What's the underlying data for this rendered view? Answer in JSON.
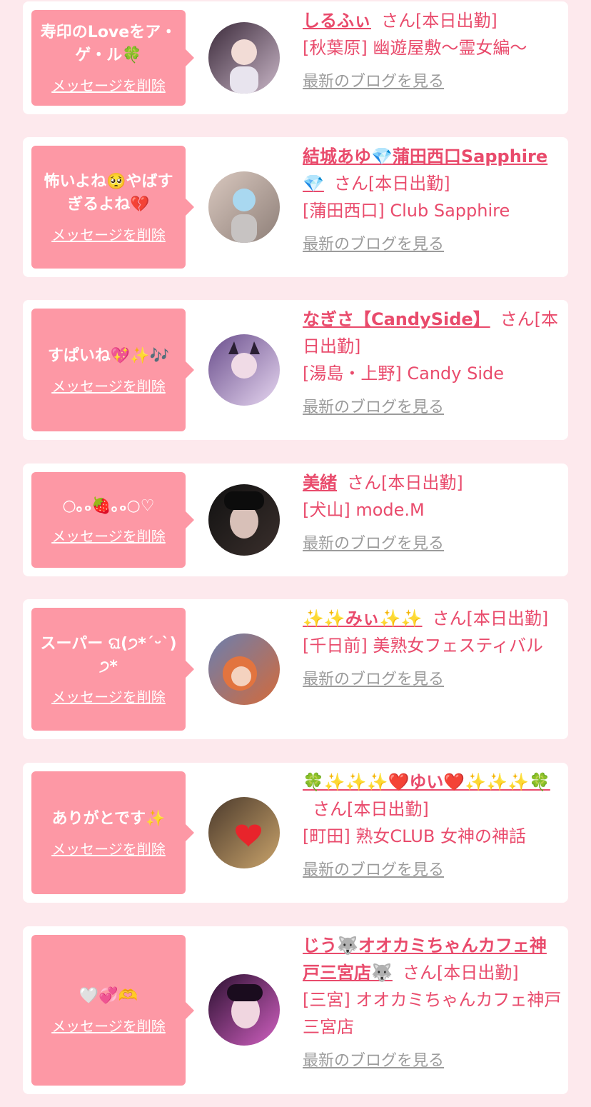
{
  "cards": [
    {
      "message": "寿印のLoveをア・ゲ・ル🍀",
      "delete_label": "メッセージを削除",
      "name": "しるふぃ",
      "suffix": "さん[本日出勤]",
      "shop": "[秋葉原] 幽遊屋敷〜霊女編〜",
      "blog_label": "最新のブログを見る",
      "avatar_colors": [
        "#3b2a3a",
        "#c9b6c7"
      ]
    },
    {
      "message": "怖いよね🥺やばすぎるよね💔",
      "delete_label": "メッセージを削除",
      "name": "結城あゆ💎蒲田西口Sapphire💎",
      "suffix": "さん[本日出勤]",
      "shop": "[蒲田西口] Club Sapphire",
      "blog_label": "最新のブログを見る",
      "avatar_colors": [
        "#d9c8bf",
        "#8e7f78"
      ]
    },
    {
      "message": "すぱいね💖✨🎶",
      "delete_label": "メッセージを削除",
      "name": "なぎさ【CandySide】",
      "suffix": "さん[本日出勤]",
      "shop": "[湯島・上野] Candy Side",
      "blog_label": "最新のブログを見る",
      "avatar_colors": [
        "#6a4e8c",
        "#e6d6f0"
      ]
    },
    {
      "message": "○｡ₒ🍓｡ₒ○♡",
      "delete_label": "メッセージを削除",
      "name": "美緒",
      "suffix": "さん[本日出勤]",
      "shop": "[犬山] mode.M",
      "blog_label": "最新のブログを見る",
      "avatar_colors": [
        "#111111",
        "#d8c0b8"
      ]
    },
    {
      "message": "スーパー ଘ(੭*ˊᵕˋ)੭*",
      "delete_label": "メッセージを削除",
      "name": "✨✨みぃ✨✨",
      "suffix": "さん[本日出勤]",
      "shop": "[千日前] 美熟女フェスティバル",
      "blog_label": "最新のブログを見る",
      "avatar_colors": [
        "#d46a3a",
        "#6a7fb0"
      ]
    },
    {
      "message": "ありがとです✨",
      "delete_label": "メッセージを削除",
      "name": "🍀✨✨✨❤️ゆい❤️✨✨✨🍀",
      "suffix": "さん[本日出勤]",
      "shop": "[町田] 熟女CLUB 女神の神話",
      "blog_label": "最新のブログを見る",
      "avatar_colors": [
        "#4b3a2c",
        "#c9a36b"
      ]
    },
    {
      "message": "🤍💞🫶",
      "delete_label": "メッセージを削除",
      "name": "じう🐺オオカミちゃんカフェ神戸三宮店🐺",
      "suffix": "さん[本日出勤]",
      "shop": "[三宮] オオカミちゃんカフェ神戸三宮店",
      "blog_label": "最新のブログを見る",
      "avatar_colors": [
        "#2b1030",
        "#d060c0"
      ]
    }
  ]
}
